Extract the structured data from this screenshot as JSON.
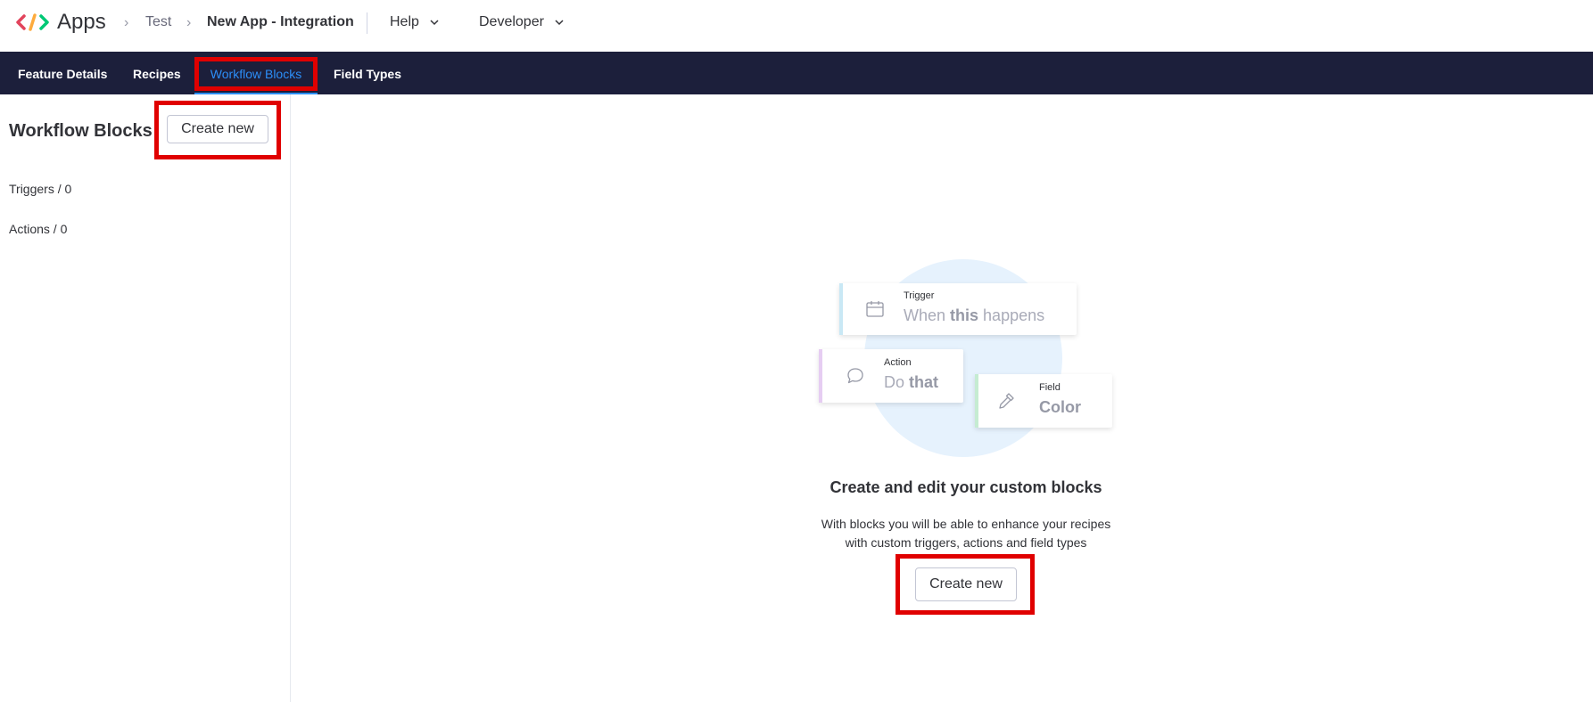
{
  "header": {
    "app_name": "Apps",
    "breadcrumbs": [
      "Test",
      "New App - Integration"
    ],
    "menus": [
      "Help",
      "Developer"
    ]
  },
  "tabs": [
    "Feature Details",
    "Recipes",
    "Workflow Blocks",
    "Field Types"
  ],
  "active_tab": "Workflow Blocks",
  "sidebar": {
    "title": "Workflow Blocks",
    "create_label": "Create new",
    "items": [
      "Triggers / 0",
      "Actions / 0"
    ]
  },
  "illustration": {
    "trigger": {
      "caption": "Trigger",
      "text_pre": "When ",
      "text_bold": "this",
      "text_post": " happens"
    },
    "action": {
      "caption": "Action",
      "text_pre": "Do ",
      "text_bold": "that"
    },
    "field": {
      "caption": "Field",
      "text_bold": "Color"
    }
  },
  "empty_state": {
    "title": "Create and edit your custom blocks",
    "description_line1": "With blocks you will be able to enhance your recipes",
    "description_line2": "with custom triggers, actions and field types",
    "create_label": "Create new"
  },
  "colors": {
    "navbar": "#1c1f3b",
    "active_tab": "#2c8ef8",
    "highlight": "#e00000",
    "trigger_stripe": "#c9e8f5",
    "action_stripe": "#e6cdf2",
    "field_stripe": "#c5ecd2"
  }
}
